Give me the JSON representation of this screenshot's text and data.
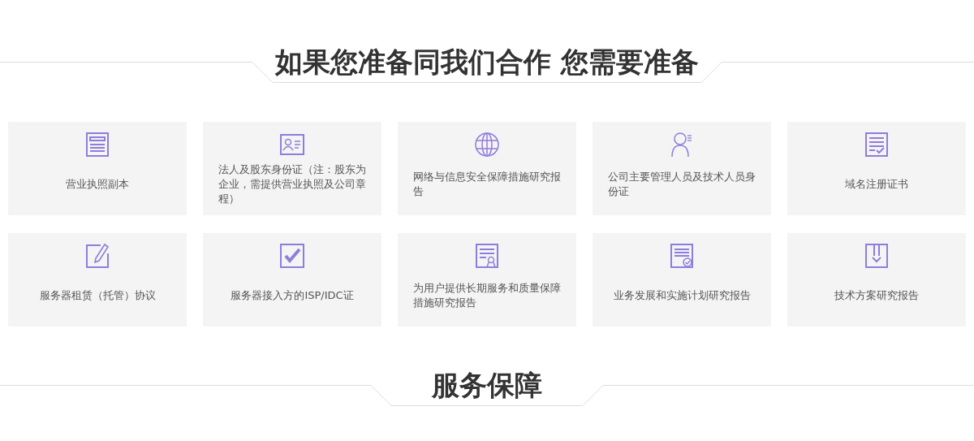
{
  "sections": [
    {
      "title": "如果您准备同我们合作 您需要准备",
      "cards": [
        {
          "label": "营业执照副本"
        },
        {
          "label": "法人及股东身份证（注：股东为企业，需提供营业执照及公司章程）"
        },
        {
          "label": "网络与信息安全保障措施研究报告"
        },
        {
          "label": "公司主要管理人员及技术人员身份证"
        },
        {
          "label": "域名注册证书"
        },
        {
          "label": "服务器租赁（托管）协议"
        },
        {
          "label": "服务器接入方的ISP/IDC证"
        },
        {
          "label": "为用户提供长期服务和质量保障措施研究报告"
        },
        {
          "label": "业务发展和实施计划研究报告"
        },
        {
          "label": "技术方案研究报告"
        }
      ]
    },
    {
      "title": "服务保障"
    }
  ]
}
